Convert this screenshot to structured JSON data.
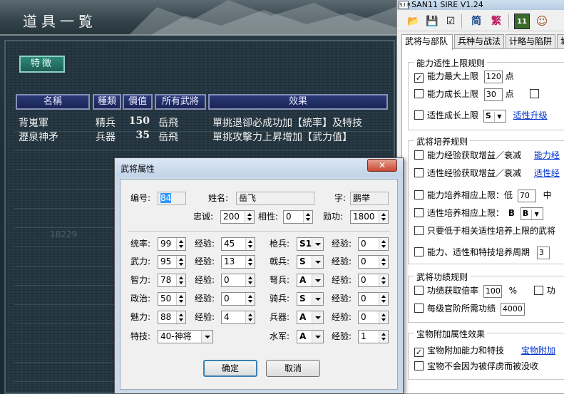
{
  "game": {
    "title": "道具一覧",
    "filter_label": "特徴",
    "columns": [
      "名稱",
      "種類",
      "價值",
      "所有武將",
      "效果"
    ],
    "rows": [
      {
        "name": "背嵬軍",
        "type": "精兵",
        "value": "150",
        "owner": "岳飛",
        "effect": "單挑退卻必成功加【統率】及特技"
      },
      {
        "name": "瀝泉神矛",
        "type": "兵器",
        "value": "35",
        "owner": "岳飛",
        "effect": "單挑攻擊力上昇增加【武力值】"
      }
    ],
    "ghost_number": "18229"
  },
  "editor": {
    "window_title": "SAN11 SIRE V1.24",
    "app_icon_text": "S.I.R",
    "toolbar": {
      "open": "📂",
      "save": "💾",
      "check": "☑",
      "simplified": "简",
      "traditional": "繁",
      "game11": "11",
      "avatar": "☺"
    },
    "tabs": [
      "武将与部队",
      "兵种与战法",
      "计略与陷阱",
      "城"
    ],
    "groups": [
      {
        "title": "能力适性上限规则",
        "rows": [
          {
            "checked": "✓",
            "label": "能力最大上限",
            "input": "120",
            "suffix": "点"
          },
          {
            "checked": "",
            "label": "能力成长上限",
            "input": "30",
            "suffix": "点",
            "extra_checked": ""
          },
          {
            "checked": "",
            "label": "适性成长上限",
            "select": "S",
            "link": "适性升级"
          }
        ]
      },
      {
        "title": "武将培养规则",
        "rows": [
          {
            "checked": "",
            "label": "能力经验获取增益／衰减",
            "link": "能力经"
          },
          {
            "checked": "",
            "label": "适性经验获取增益／衰减",
            "link": "适性经"
          },
          {
            "checked": "",
            "label": "能力培养相应上限：低",
            "input": "70",
            "suffix": "中"
          },
          {
            "checked": "",
            "label": "适性培养相应上限：",
            "select": "B",
            "select2": "B"
          },
          {
            "checked": "",
            "label": "只要低于相关适性培养上限的武将"
          },
          {
            "checked": "",
            "label": "能力、适性和特技培养周期",
            "input": "3"
          }
        ]
      },
      {
        "title": "武将功绩规则",
        "rows": [
          {
            "checked": "",
            "label": "功绩获取倍率",
            "input": "100",
            "suffix": "%",
            "extra_label": "功"
          },
          {
            "checked": "",
            "label": "每级官阶所需功绩",
            "input": "4000"
          }
        ]
      },
      {
        "title": "宝物附加属性效果",
        "rows": [
          {
            "checked": "✓",
            "label": "宝物附加能力和特技",
            "link": "宝物附加"
          },
          {
            "checked": "",
            "label": "宝物不会因为被俘虏而被没收"
          }
        ]
      }
    ]
  },
  "dialog": {
    "title": "武将属性",
    "close_label": "✕",
    "fields": {
      "id_label": "编号:",
      "id_value": "84",
      "name_label": "姓名:",
      "name_value": "岳飞",
      "zi_label": "字:",
      "zi_value": "鹏举",
      "loyalty_label": "忠诚:",
      "loyalty_value": "200",
      "affinity_label": "相性:",
      "affinity_value": "0",
      "merit_label": "勋功:",
      "merit_value": "1800"
    },
    "stats": [
      {
        "label": "统率:",
        "value": "99",
        "exp_label": "经验:",
        "exp": "45"
      },
      {
        "label": "武力:",
        "value": "95",
        "exp_label": "经验:",
        "exp": "13"
      },
      {
        "label": "智力:",
        "value": "78",
        "exp_label": "经验:",
        "exp": "0"
      },
      {
        "label": "政治:",
        "value": "50",
        "exp_label": "经验:",
        "exp": "0"
      },
      {
        "label": "魅力:",
        "value": "88",
        "exp_label": "经验:",
        "exp": "4"
      }
    ],
    "skill_label": "特技:",
    "skill_value": "40-神将",
    "aptitudes": [
      {
        "label": "枪兵:",
        "value": "S1",
        "exp_label": "经验:",
        "exp": "0"
      },
      {
        "label": "戟兵:",
        "value": "S",
        "exp_label": "经验:",
        "exp": "0"
      },
      {
        "label": "弩兵:",
        "value": "A",
        "exp_label": "经验:",
        "exp": "0"
      },
      {
        "label": "骑兵:",
        "value": "S",
        "exp_label": "经验:",
        "exp": "0"
      },
      {
        "label": "兵器:",
        "value": "A",
        "exp_label": "经验:",
        "exp": "0"
      },
      {
        "label": "水军:",
        "value": "A",
        "exp_label": "经验:",
        "exp": "1"
      }
    ],
    "ok_label": "确定",
    "cancel_label": "取消"
  }
}
